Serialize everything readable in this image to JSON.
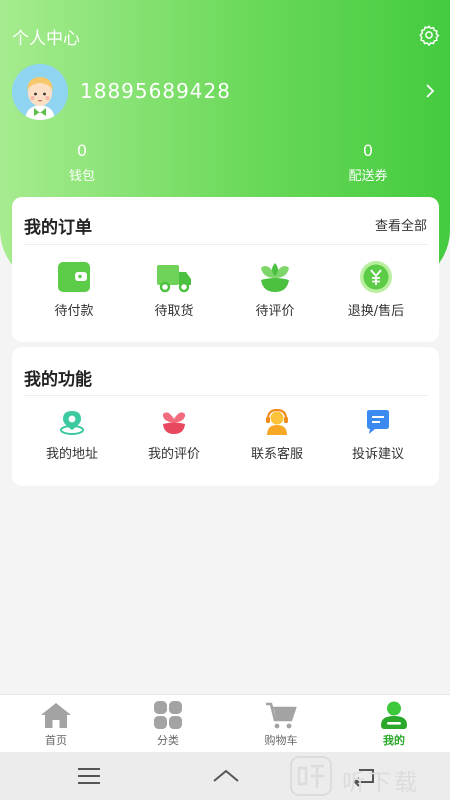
{
  "header": {
    "title": "个人中心",
    "phone": "18895689428",
    "stats": [
      {
        "value": "0",
        "label": "钱包"
      },
      {
        "value": "0",
        "label": "配送券"
      }
    ]
  },
  "orders": {
    "title": "我的订单",
    "view_all": "查看全部",
    "items": [
      {
        "label": "待付款",
        "icon": "wallet-icon"
      },
      {
        "label": "待取货",
        "icon": "truck-icon"
      },
      {
        "label": "待评价",
        "icon": "flower-icon"
      },
      {
        "label": "退换/售后",
        "icon": "yen-icon"
      }
    ]
  },
  "functions": {
    "title": "我的功能",
    "items": [
      {
        "label": "我的地址",
        "icon": "location-icon"
      },
      {
        "label": "我的评价",
        "icon": "heart-flower-icon"
      },
      {
        "label": "联系客服",
        "icon": "customer-service-icon"
      },
      {
        "label": "投诉建议",
        "icon": "message-icon"
      }
    ]
  },
  "tabbar": {
    "tabs": [
      {
        "label": "首页",
        "icon": "home-icon",
        "active": false
      },
      {
        "label": "分类",
        "icon": "category-icon",
        "active": false
      },
      {
        "label": "购物车",
        "icon": "cart-icon",
        "active": false
      },
      {
        "label": "我的",
        "icon": "profile-icon",
        "active": true
      }
    ]
  },
  "watermark": {
    "text": "听下载"
  },
  "colors": {
    "accent": "#44cb3f",
    "header_light": "#a6ec8f",
    "active_tab": "#2aa82a"
  }
}
